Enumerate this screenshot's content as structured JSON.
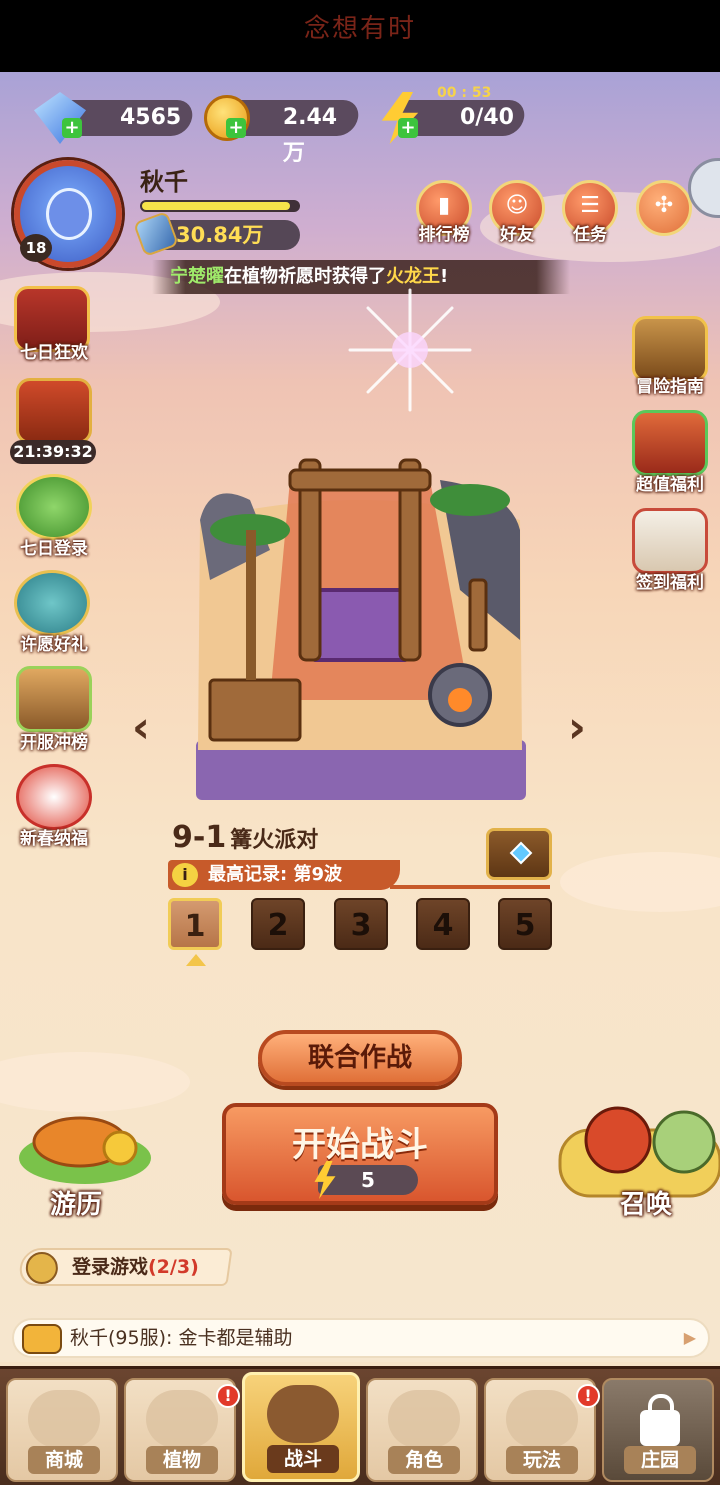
{
  "status_bar": {
    "title": "念想有时"
  },
  "resources": {
    "gems": "4565",
    "gold": "2.44万",
    "stamina": "0/40",
    "stamina_timer": "00 : 53"
  },
  "player": {
    "name": "秋千",
    "level": "18",
    "power": "30.84万",
    "xp_fraction": 0.95
  },
  "top_buttons": [
    {
      "label": "排行榜",
      "icon": "leaderboard-icon"
    },
    {
      "label": "好友",
      "icon": "friends-icon"
    },
    {
      "label": "任务",
      "icon": "tasks-icon"
    },
    {
      "label": "",
      "icon": "menu-icon"
    }
  ],
  "news": {
    "player": "宁楚曜",
    "text": "在植物祈愿时获得了",
    "item": "火龙王",
    "end": "!"
  },
  "left_events": [
    {
      "label": "七日狂欢",
      "icon": "seven-day-carnival-icon"
    },
    {
      "label": "",
      "icon": "gift-chest-icon",
      "timer": "21:39:32"
    },
    {
      "label": "七日登录",
      "icon": "seven-day-login-icon"
    },
    {
      "label": "许愿好礼",
      "icon": "wish-gift-icon"
    },
    {
      "label": "开服冲榜",
      "icon": "server-ranking-icon"
    },
    {
      "label": "新春纳福",
      "icon": "spring-festival-icon"
    }
  ],
  "right_events": [
    {
      "label": "冒险指南",
      "icon": "adventure-guide-icon"
    },
    {
      "label": "超值福利",
      "icon": "value-benefit-icon"
    },
    {
      "label": "签到福利",
      "icon": "checkin-benefit-icon"
    }
  ],
  "stage": {
    "number": "9-1",
    "name": "篝火派对",
    "record_label": "最高记录: 第9波",
    "levels": [
      "1",
      "2",
      "3",
      "4",
      "5"
    ],
    "selected_level": "1"
  },
  "buttons": {
    "coop": "联合作战",
    "start": "开始战斗",
    "start_cost": "5",
    "travel": "游历",
    "summon": "召唤"
  },
  "quest": {
    "text": "登录游戏",
    "progress": "(2/3)"
  },
  "chat": {
    "text": "秋千(95服):  金卡都是辅助"
  },
  "bottom_nav": [
    {
      "label": "商城",
      "badge": ""
    },
    {
      "label": "植物",
      "badge": "!"
    },
    {
      "label": "战斗",
      "badge": ""
    },
    {
      "label": "角色",
      "badge": ""
    },
    {
      "label": "玩法",
      "badge": "!"
    },
    {
      "label": "庄园",
      "badge": ""
    }
  ],
  "colors": {
    "accent": "#d9562e",
    "news_highlight": "#ffd84a",
    "player_highlight": "#9fea6a"
  }
}
